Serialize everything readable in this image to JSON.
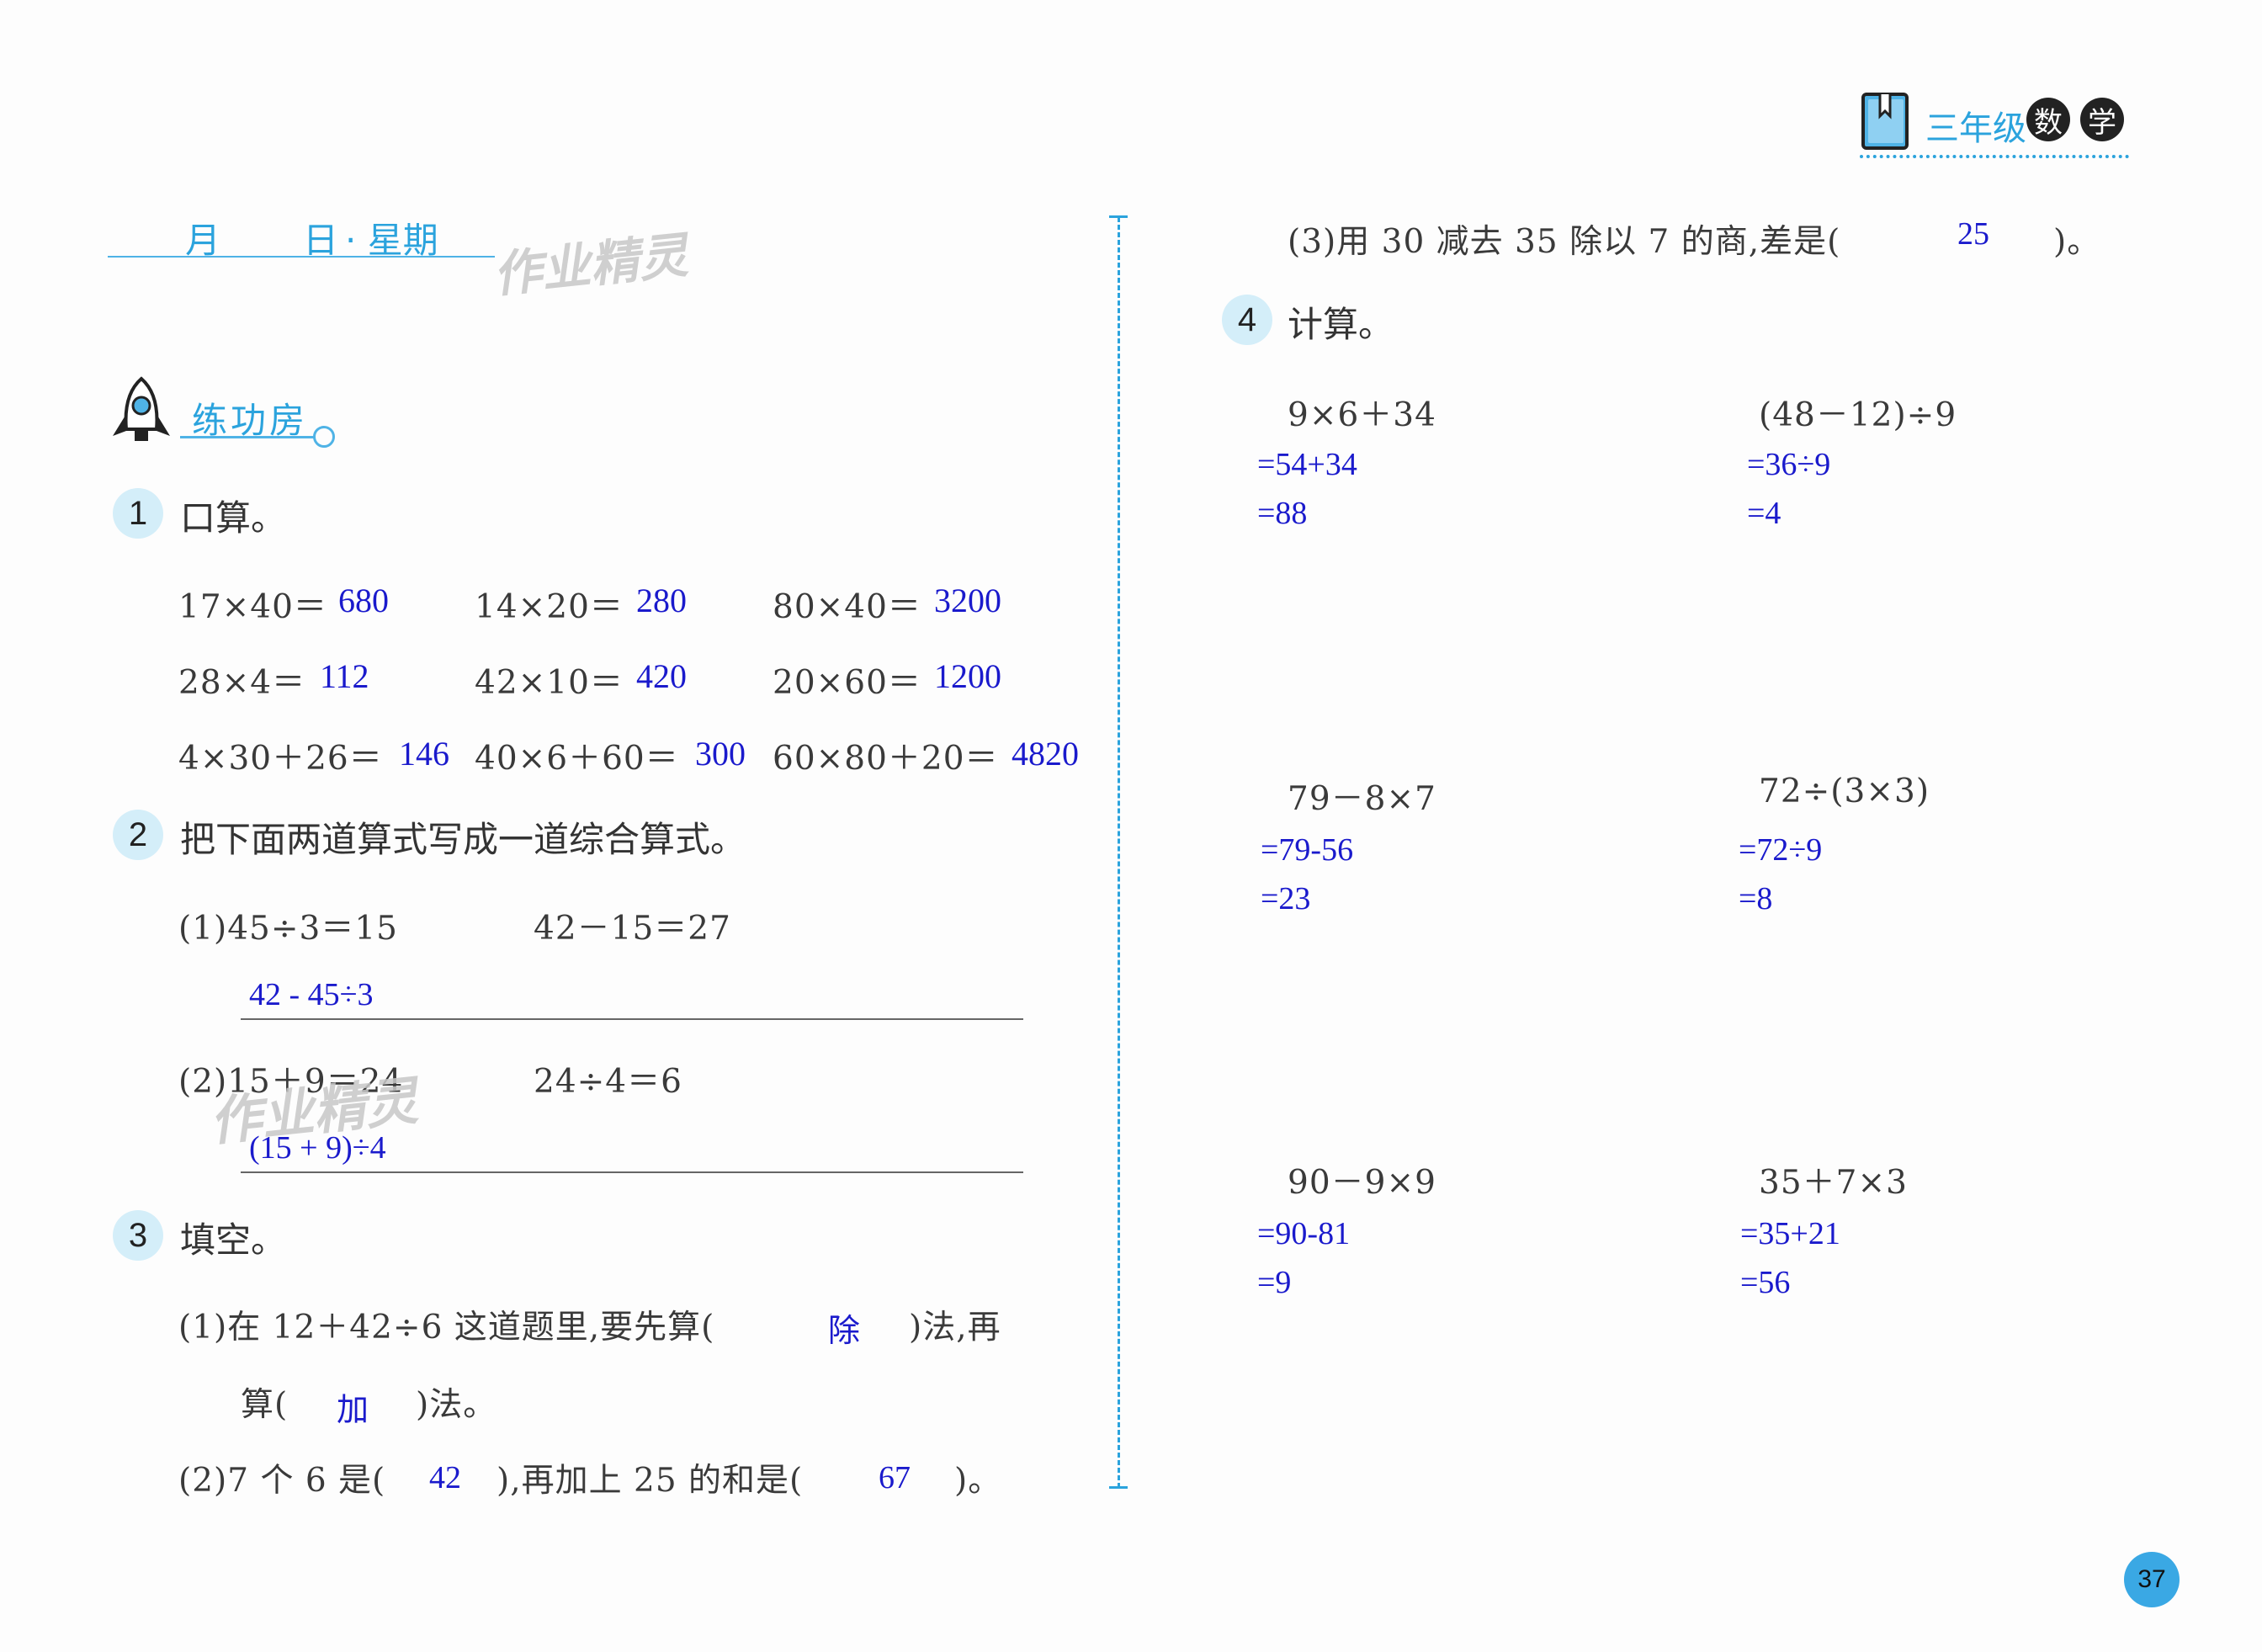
{
  "header": {
    "grade": "三年级",
    "subject_1": "数",
    "subject_2": "学"
  },
  "date_line": {
    "month": "月",
    "day": "日",
    "week": "· 星期"
  },
  "watermark": "作业精灵",
  "section": {
    "title": "练功房"
  },
  "q1": {
    "num": "1",
    "title": "口算。",
    "rows": [
      [
        {
          "p": "17×40＝",
          "a": "680"
        },
        {
          "p": "14×20＝",
          "a": "280"
        },
        {
          "p": "80×40＝",
          "a": "3200"
        }
      ],
      [
        {
          "p": "28×4＝",
          "a": "112"
        },
        {
          "p": "42×10＝",
          "a": "420"
        },
        {
          "p": "20×60＝",
          "a": "1200"
        }
      ],
      [
        {
          "p": "4×30＋26＝",
          "a": "146"
        },
        {
          "p": "40×6＋60＝",
          "a": "300"
        },
        {
          "p": "60×80＋20＝",
          "a": "4820"
        }
      ]
    ]
  },
  "q2": {
    "num": "2",
    "title": "把下面两道算式写成一道综合算式。",
    "p1_a": "(1)45÷3＝15",
    "p1_b": "42－15＝27",
    "p1_ans": "42 - 45÷3",
    "p2_a": "(2)15＋9＝24",
    "p2_b": "24÷4＝6",
    "p2_ans": "(15 + 9)÷4"
  },
  "q3": {
    "num": "3",
    "title": "填空。",
    "l1_a": "(1)在 12＋42÷6 这道题里,要先算(",
    "l1_ans": "除",
    "l1_b": ")法,再",
    "l2_a": "算(",
    "l2_ans": "加",
    "l2_b": ")法。",
    "l3_a": "(2)7 个 6 是(",
    "l3_ans1": "42",
    "l3_b": "),再加上 25 的和是(",
    "l3_ans2": "67",
    "l3_c": ")。",
    "l4_a": "(3)用 30 减去 35 除以 7 的商,差是(",
    "l4_ans": "25",
    "l4_b": ")。"
  },
  "q4": {
    "num": "4",
    "title": "计算。",
    "items": [
      {
        "p": "9×6＋34",
        "s1": "=54+34",
        "s2": "=88"
      },
      {
        "p": "(48－12)÷9",
        "s1": "=36÷9",
        "s2": "=4"
      },
      {
        "p": "79－8×7",
        "s1": "=79-56",
        "s2": "=23"
      },
      {
        "p": "72÷(3×3)",
        "s1": "=72÷9",
        "s2": "=8"
      },
      {
        "p": "90－9×9",
        "s1": "=90-81",
        "s2": "=9"
      },
      {
        "p": "35＋7×3",
        "s1": "=35+21",
        "s2": "=56"
      }
    ]
  },
  "page_number": "37"
}
